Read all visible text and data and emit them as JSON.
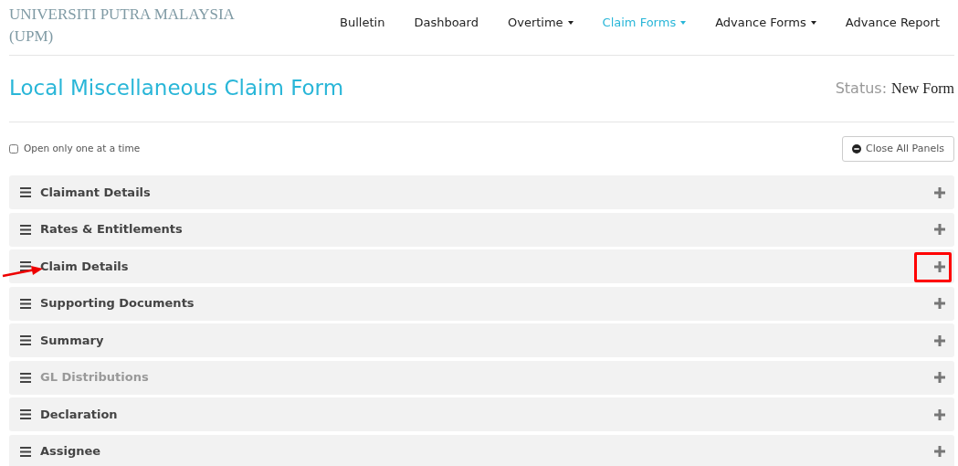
{
  "brand": "UNIVERSITI PUTRA MALAYSIA (UPM)",
  "nav": [
    {
      "label": "Bulletin",
      "dropdown": false,
      "selected": false
    },
    {
      "label": "Dashboard",
      "dropdown": false,
      "selected": false
    },
    {
      "label": "Overtime",
      "dropdown": true,
      "selected": false
    },
    {
      "label": "Claim Forms",
      "dropdown": true,
      "selected": true
    },
    {
      "label": "Advance Forms",
      "dropdown": true,
      "selected": false
    },
    {
      "label": "Advance Report",
      "dropdown": false,
      "selected": false
    }
  ],
  "title": "Local Miscellaneous Claim Form",
  "status": {
    "label": "Status:",
    "value": "New Form"
  },
  "open_one": {
    "label": "Open only one at a time",
    "checked": false
  },
  "close_all_button": "Close All Panels",
  "panels": [
    {
      "title": "Claimant Details",
      "disabled": false,
      "expanded": false,
      "highlighted": false
    },
    {
      "title": "Rates & Entitlements",
      "disabled": false,
      "expanded": false,
      "highlighted": false
    },
    {
      "title": "Claim Details",
      "disabled": false,
      "expanded": false,
      "highlighted": true
    },
    {
      "title": "Supporting Documents",
      "disabled": false,
      "expanded": false,
      "highlighted": false
    },
    {
      "title": "Summary",
      "disabled": false,
      "expanded": false,
      "highlighted": false
    },
    {
      "title": "GL Distributions",
      "disabled": true,
      "expanded": false,
      "highlighted": false
    },
    {
      "title": "Declaration",
      "disabled": false,
      "expanded": false,
      "highlighted": false
    },
    {
      "title": "Assignee",
      "disabled": false,
      "expanded": false,
      "highlighted": false
    }
  ]
}
